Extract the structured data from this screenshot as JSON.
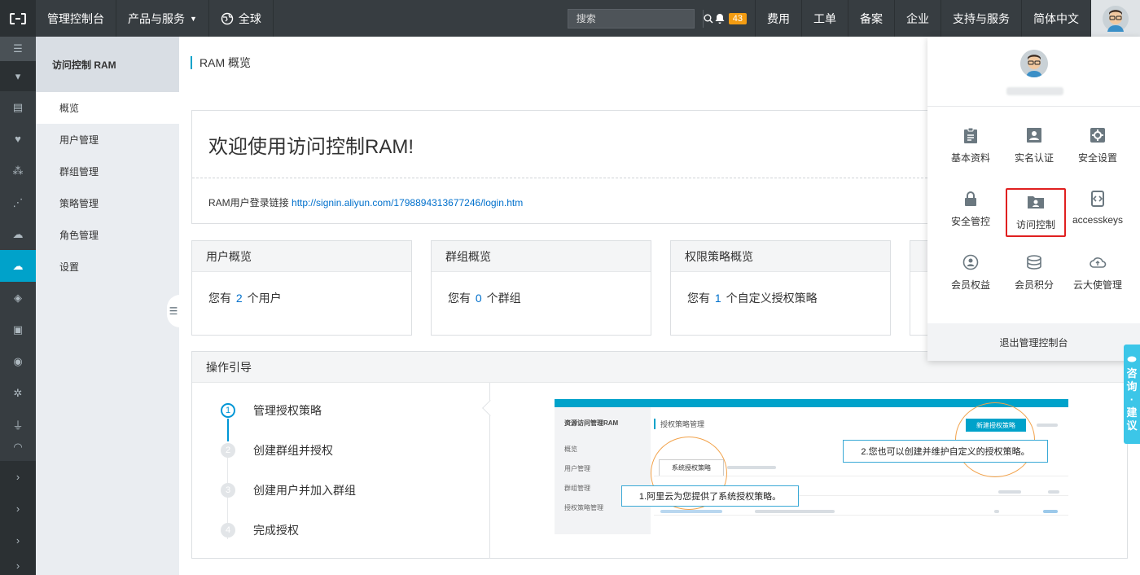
{
  "topbar": {
    "console": "管理控制台",
    "products": "产品与服务",
    "region": "全球",
    "search_placeholder": "搜索",
    "notification_count": "43",
    "nav": [
      "费用",
      "工单",
      "备案",
      "企业",
      "支持与服务",
      "简体中文"
    ]
  },
  "subnav": {
    "title": "访问控制 RAM",
    "items": [
      "概览",
      "用户管理",
      "群组管理",
      "策略管理",
      "角色管理",
      "设置"
    ]
  },
  "main": {
    "page_title": "RAM 概览",
    "welcome_title": "欢迎使用访问控制RAM!",
    "login_label": "RAM用户登录链接",
    "login_url": "http://signin.aliyun.com/1798894313677246/login.htm",
    "cards": [
      {
        "title": "用户概览",
        "pre": "您有",
        "num": "2",
        "post": "个用户"
      },
      {
        "title": "群组概览",
        "pre": "您有",
        "num": "0",
        "post": "个群组"
      },
      {
        "title": "权限策略概览",
        "pre": "您有",
        "num": "1",
        "post": "个自定义授权策略"
      }
    ],
    "guide_title": "操作引导",
    "steps": [
      {
        "n": "1",
        "label": "管理授权策略"
      },
      {
        "n": "2",
        "label": "创建群组并授权"
      },
      {
        "n": "3",
        "label": "创建用户并加入群组"
      },
      {
        "n": "4",
        "label": "完成授权"
      }
    ],
    "illustration": {
      "side_title": "资源访问管理RAM",
      "side_items": [
        "概览",
        "用户管理",
        "群组管理",
        "授权策略管理"
      ],
      "page_title": "授权策略管理",
      "new_button": "新建授权策略",
      "tab": "系统授权策略",
      "callout1": "1.阿里云为您提供了系统授权策略。",
      "callout2": "2.您也可以创建并维护自定义的授权策略。"
    }
  },
  "dropdown": {
    "items": [
      {
        "label": "基本资料",
        "icon": "clipboard-icon"
      },
      {
        "label": "实名认证",
        "icon": "id-card-icon"
      },
      {
        "label": "安全设置",
        "icon": "gear-icon"
      },
      {
        "label": "安全管控",
        "icon": "lock-icon"
      },
      {
        "label": "访问控制",
        "icon": "folder-user-icon"
      },
      {
        "label": "accesskeys",
        "icon": "key-code-icon"
      },
      {
        "label": "会员权益",
        "icon": "member-icon"
      },
      {
        "label": "会员积分",
        "icon": "coins-icon"
      },
      {
        "label": "云大使管理",
        "icon": "cloud-icon"
      }
    ],
    "logout": "退出管理控制台"
  },
  "consult": {
    "lines": [
      "咨",
      "询",
      "·",
      "建",
      "议"
    ]
  },
  "colors": {
    "topbar": "#373d41",
    "accent": "#00a2ca",
    "link": "#0070cc",
    "badge": "#f39c12",
    "highlight": "#e02020"
  }
}
